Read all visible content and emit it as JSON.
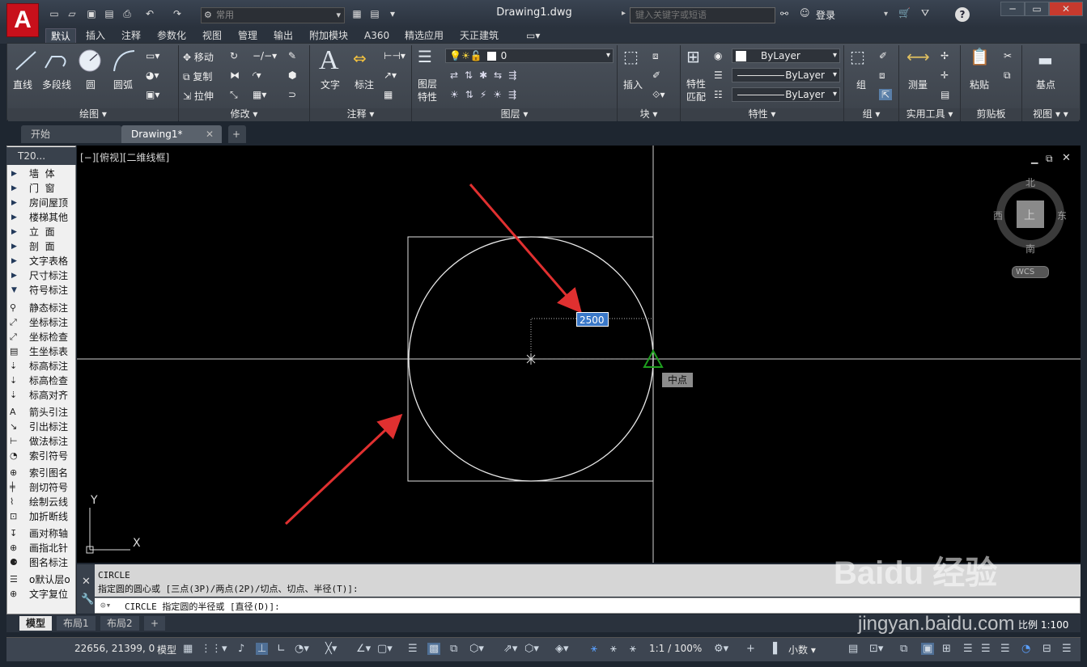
{
  "app": {
    "logo": "A",
    "doc_title": "Drawing1.dwg",
    "workspace": "常用",
    "search_placeholder": "键入关键字或短语",
    "login": "登录"
  },
  "menu_tabs": [
    "默认",
    "插入",
    "注释",
    "参数化",
    "视图",
    "管理",
    "输出",
    "附加模块",
    "A360",
    "精选应用",
    "天正建筑"
  ],
  "ribbon": {
    "draw": {
      "title": "绘图",
      "line": "直线",
      "polyline": "多段线",
      "circle": "圆",
      "arc": "圆弧"
    },
    "modify": {
      "title": "修改",
      "move": "移动",
      "copy": "复制",
      "stretch": "拉伸"
    },
    "annotation": {
      "title": "注释",
      "text": "文字",
      "dimension": "标注"
    },
    "layers": {
      "title": "图层",
      "layer_props": "图层\n特性",
      "layer_value": "0"
    },
    "block": {
      "title": "块",
      "insert": "插入"
    },
    "properties": {
      "title": "特性",
      "match": "特性\n匹配",
      "color": "ByLayer",
      "linetype": "ByLayer",
      "lineweight": "ByLayer"
    },
    "groups": {
      "title": "组",
      "group": "组"
    },
    "utilities": {
      "title": "实用工具",
      "measure": "测量"
    },
    "clipboard": {
      "title": "剪贴板",
      "paste": "粘贴"
    },
    "view": {
      "title": "视图",
      "base": "基点"
    }
  },
  "doc_tabs": [
    "开始",
    "Drawing1*"
  ],
  "sidebar": {
    "header": "T20...",
    "items": [
      {
        "label": "墙  体",
        "kind": "tri"
      },
      {
        "label": "门  窗",
        "kind": "tri"
      },
      {
        "label": "房间屋顶",
        "kind": "tri"
      },
      {
        "label": "楼梯其他",
        "kind": "tri"
      },
      {
        "label": "立  面",
        "kind": "tri"
      },
      {
        "label": "剖  面",
        "kind": "tri"
      },
      {
        "label": "文字表格",
        "kind": "tri"
      },
      {
        "label": "尺寸标注",
        "kind": "tri"
      },
      {
        "label": "符号标注",
        "kind": "down"
      },
      {
        "label": "静态标注",
        "kind": "icon"
      },
      {
        "label": "坐标标注",
        "kind": "icon"
      },
      {
        "label": "坐标检查",
        "kind": "icon"
      },
      {
        "label": "生坐标表",
        "kind": "icon"
      },
      {
        "label": "标高标注",
        "kind": "icon"
      },
      {
        "label": "标高检查",
        "kind": "icon"
      },
      {
        "label": "标高对齐",
        "kind": "icon"
      },
      {
        "label": "箭头引注",
        "kind": "icon"
      },
      {
        "label": "引出标注",
        "kind": "icon"
      },
      {
        "label": "做法标注",
        "kind": "icon"
      },
      {
        "label": "索引符号",
        "kind": "icon"
      },
      {
        "label": "索引图名",
        "kind": "icon"
      },
      {
        "label": "剖切符号",
        "kind": "icon"
      },
      {
        "label": "绘制云线",
        "kind": "icon"
      },
      {
        "label": "加折断线",
        "kind": "icon"
      },
      {
        "label": "画对称轴",
        "kind": "icon"
      },
      {
        "label": "画指北针",
        "kind": "icon"
      },
      {
        "label": "图名标注",
        "kind": "icon"
      },
      {
        "label": "o默认层o",
        "kind": "icon"
      },
      {
        "label": "文字复位",
        "kind": "icon"
      }
    ]
  },
  "viewport": {
    "label": "[−][俯视][二维线框]",
    "radius_input": "2500",
    "snap_tooltip": "中点",
    "axis_y": "Y",
    "axis_x": "X",
    "viewcube": {
      "north": "北",
      "south": "南",
      "east": "东",
      "west": "西",
      "top": "上",
      "wcs": "WCS"
    }
  },
  "command": {
    "history_1": "CIRCLE",
    "history_2": "指定圆的圆心或 [三点(3P)/两点(2P)/切点、切点、半径(T)]:",
    "prompt": "CIRCLE 指定圆的半径或 [直径(D)]:"
  },
  "layout_tabs": [
    "模型",
    "布局1",
    "布局2"
  ],
  "status": {
    "coords": "22656, 21399, 0",
    "model": "模型",
    "scale": "1:1 / 100%",
    "units": "小数",
    "annotation_scale": "比例 1:100"
  },
  "watermark": {
    "logo": "Baidu 经验",
    "url": "jingyan.baidu.com"
  },
  "colors": {
    "accent": "#c8101b",
    "arrow": "#e03030",
    "snap_marker": "#1e9e1e",
    "input_bg": "#3a78c8"
  }
}
